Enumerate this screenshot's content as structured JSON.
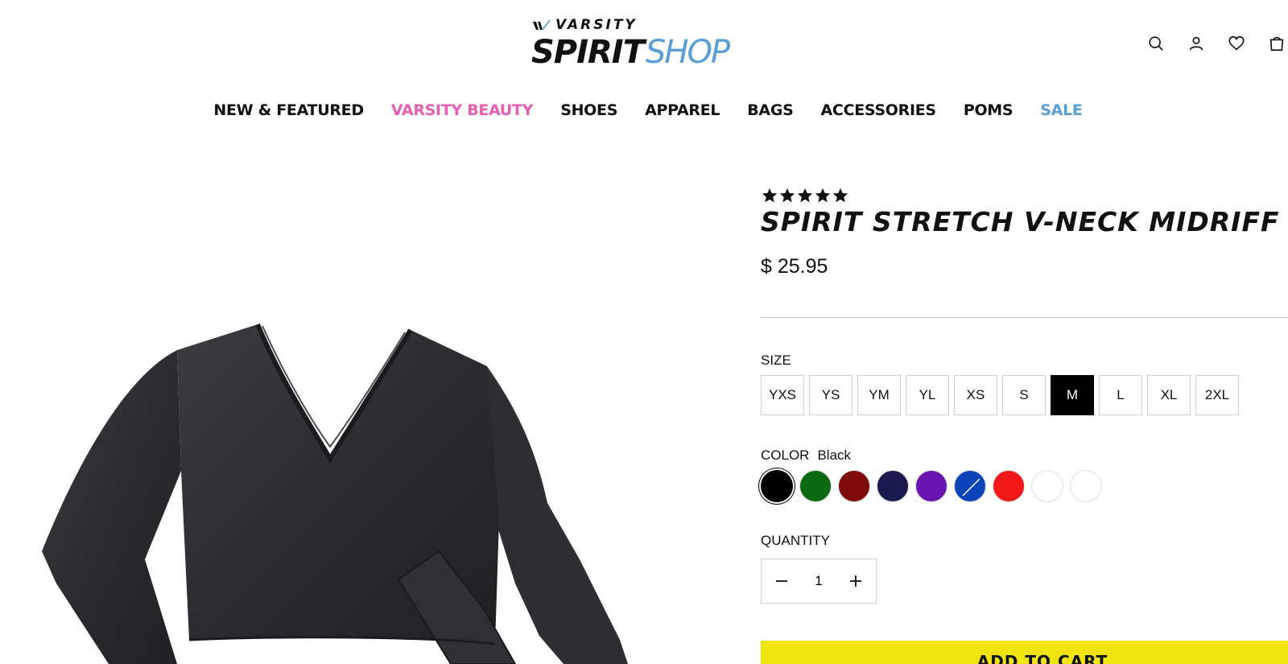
{
  "header": {
    "logo_top": "VARSITY",
    "logo_main": "SPIRIT",
    "logo_accent": "SHOP",
    "icons": [
      "search-icon",
      "account-icon",
      "wishlist-icon",
      "cart-icon"
    ]
  },
  "nav": {
    "items": [
      {
        "label": "NEW & FEATURED",
        "color": "#111111"
      },
      {
        "label": "VARSITY BEAUTY",
        "color": "#e65fb2"
      },
      {
        "label": "SHOES",
        "color": "#111111"
      },
      {
        "label": "APPAREL",
        "color": "#111111"
      },
      {
        "label": "BAGS",
        "color": "#111111"
      },
      {
        "label": "ACCESSORIES",
        "color": "#111111"
      },
      {
        "label": "POMS",
        "color": "#111111"
      },
      {
        "label": "SALE",
        "color": "#5a9fd4"
      }
    ]
  },
  "product": {
    "rating": 5,
    "title": "SPIRIT STRETCH V-NECK MIDRIFF",
    "price": "$ 25.95",
    "size_label": "SIZE",
    "sizes": [
      "YXS",
      "YS",
      "YM",
      "YL",
      "XS",
      "S",
      "M",
      "L",
      "XL",
      "2XL"
    ],
    "selected_size": "M",
    "color_label": "COLOR",
    "selected_color": "Black",
    "swatches": [
      {
        "name": "Black",
        "hex": "#000000"
      },
      {
        "name": "Green",
        "hex": "#0a6a12"
      },
      {
        "name": "Maroon",
        "hex": "#7e0a0a"
      },
      {
        "name": "Navy",
        "hex": "#1b1a4e"
      },
      {
        "name": "Purple",
        "hex": "#6a14b2"
      },
      {
        "name": "Royal",
        "hex": "#0a44b8"
      },
      {
        "name": "Red",
        "hex": "#f21818"
      },
      {
        "name": "White",
        "hex": "#ffffff"
      },
      {
        "name": "White",
        "hex": "#ffffff"
      }
    ],
    "quantity_label": "QUANTITY",
    "quantity": "1",
    "add_to_cart": "ADD TO CART"
  },
  "colors": {
    "accent_pink": "#e65fb2",
    "accent_blue": "#5a9fd4",
    "cart_button": "#f0e40e"
  }
}
